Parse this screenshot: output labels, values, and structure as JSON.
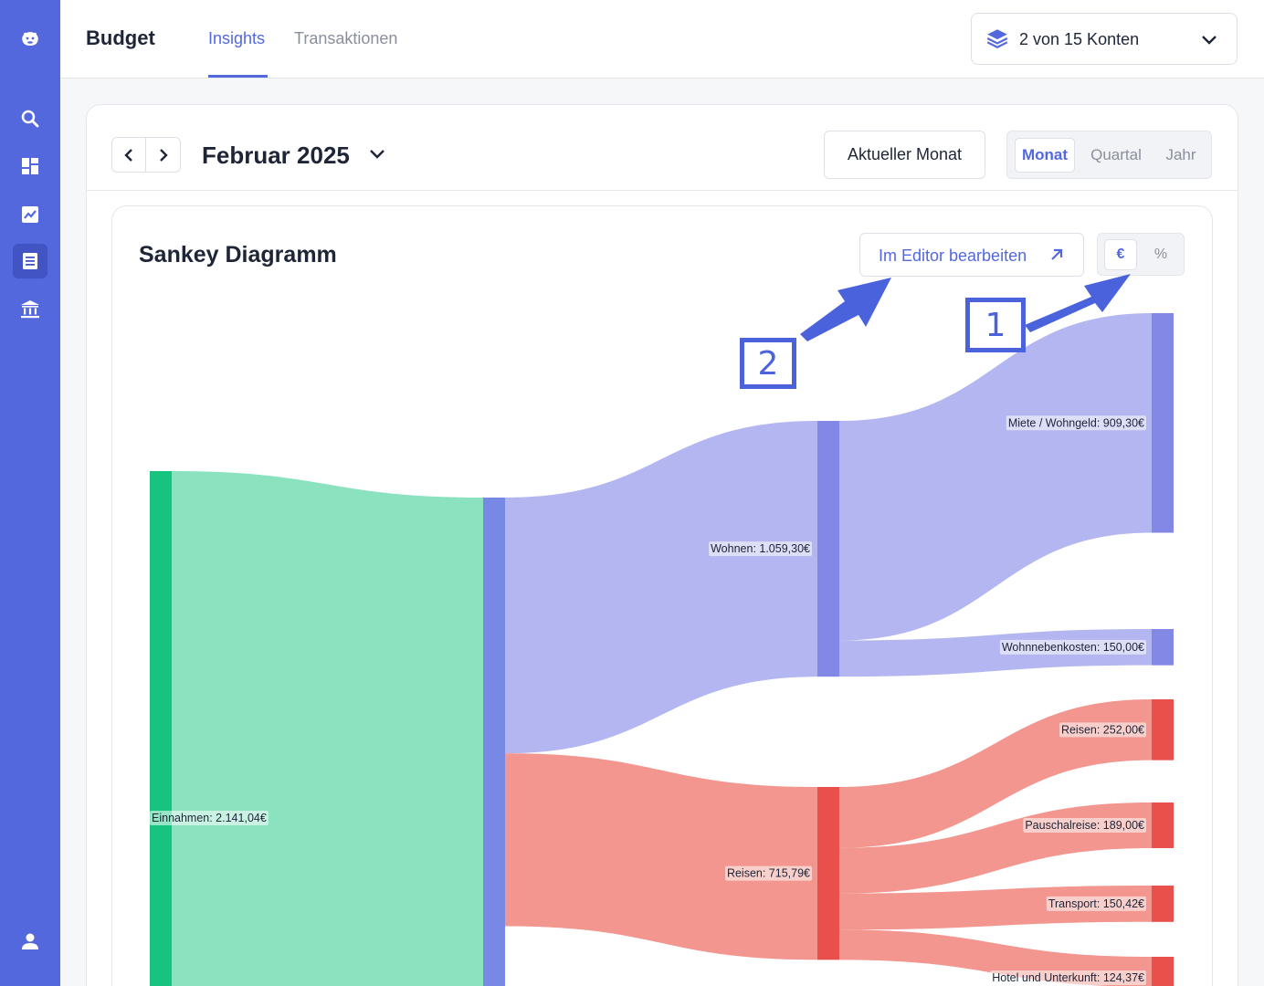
{
  "app": {
    "title": "Budget",
    "tabs": [
      {
        "label": "Insights",
        "active": true
      },
      {
        "label": "Transaktionen",
        "active": false
      }
    ],
    "account_selector": {
      "label": "2 von 15 Konten",
      "icon": "layers-icon"
    }
  },
  "sidebar": {
    "items": [
      {
        "name": "logo",
        "icon": "hippo-logo-icon"
      },
      {
        "name": "search",
        "icon": "search-icon"
      },
      {
        "name": "dashboard",
        "icon": "dashboard-icon"
      },
      {
        "name": "analytics",
        "icon": "chart-icon"
      },
      {
        "name": "budget",
        "icon": "list-icon",
        "active": true
      },
      {
        "name": "bank",
        "icon": "bank-icon"
      },
      {
        "name": "profile",
        "icon": "user-icon"
      }
    ]
  },
  "period": {
    "label": "Februar 2025",
    "current_button": "Aktueller Monat",
    "ranges": [
      "Monat",
      "Quartal",
      "Jahr"
    ],
    "active_range": "Monat"
  },
  "chart": {
    "title": "Sankey Diagramm",
    "edit_button": "Im Editor bearbeiten",
    "units": [
      "€",
      "%"
    ],
    "active_unit": "€"
  },
  "annotations": [
    "1",
    "2"
  ],
  "colors": {
    "accent": "#5468de",
    "income": "#16c47f",
    "income_flow": "#8ae2bf",
    "housing_node": "#8388e6",
    "housing_flow": "#b3b6f0",
    "travel_node": "#e8504b",
    "travel_flow": "#f2968f",
    "budget_node": "#7788e5"
  },
  "chart_data": {
    "type": "sankey",
    "title": "Sankey Diagramm",
    "nodes": [
      {
        "id": "einnahmen",
        "label": "Einnahmen: 2.141,04€",
        "value": 2141.04
      },
      {
        "id": "budget",
        "label": "",
        "value": 2141.04
      },
      {
        "id": "wohnen",
        "label": "Wohnen: 1.059,30€",
        "value": 1059.3
      },
      {
        "id": "reisen",
        "label": "Reisen: 715,79€",
        "value": 715.79
      },
      {
        "id": "miete",
        "label": "Miete / Wohngeld: 909,30€",
        "value": 909.3
      },
      {
        "id": "wohnnebenkosten",
        "label": "Wohnnebenkosten: 150,00€",
        "value": 150.0
      },
      {
        "id": "reisen_sub",
        "label": "Reisen: 252,00€",
        "value": 252.0
      },
      {
        "id": "pauschalreise",
        "label": "Pauschalreise: 189,00€",
        "value": 189.0
      },
      {
        "id": "transport",
        "label": "Transport: 150,42€",
        "value": 150.42
      },
      {
        "id": "hotel",
        "label": "Hotel und Unterkunft: 124,37€",
        "value": 124.37
      }
    ],
    "links": [
      {
        "source": "einnahmen",
        "target": "budget",
        "value": 2141.04
      },
      {
        "source": "budget",
        "target": "wohnen",
        "value": 1059.3
      },
      {
        "source": "budget",
        "target": "reisen",
        "value": 715.79
      },
      {
        "source": "wohnen",
        "target": "miete",
        "value": 909.3
      },
      {
        "source": "wohnen",
        "target": "wohnnebenkosten",
        "value": 150.0
      },
      {
        "source": "reisen",
        "target": "reisen_sub",
        "value": 252.0
      },
      {
        "source": "reisen",
        "target": "pauschalreise",
        "value": 189.0
      },
      {
        "source": "reisen",
        "target": "transport",
        "value": 150.42
      },
      {
        "source": "reisen",
        "target": "hotel",
        "value": 124.37
      }
    ]
  }
}
